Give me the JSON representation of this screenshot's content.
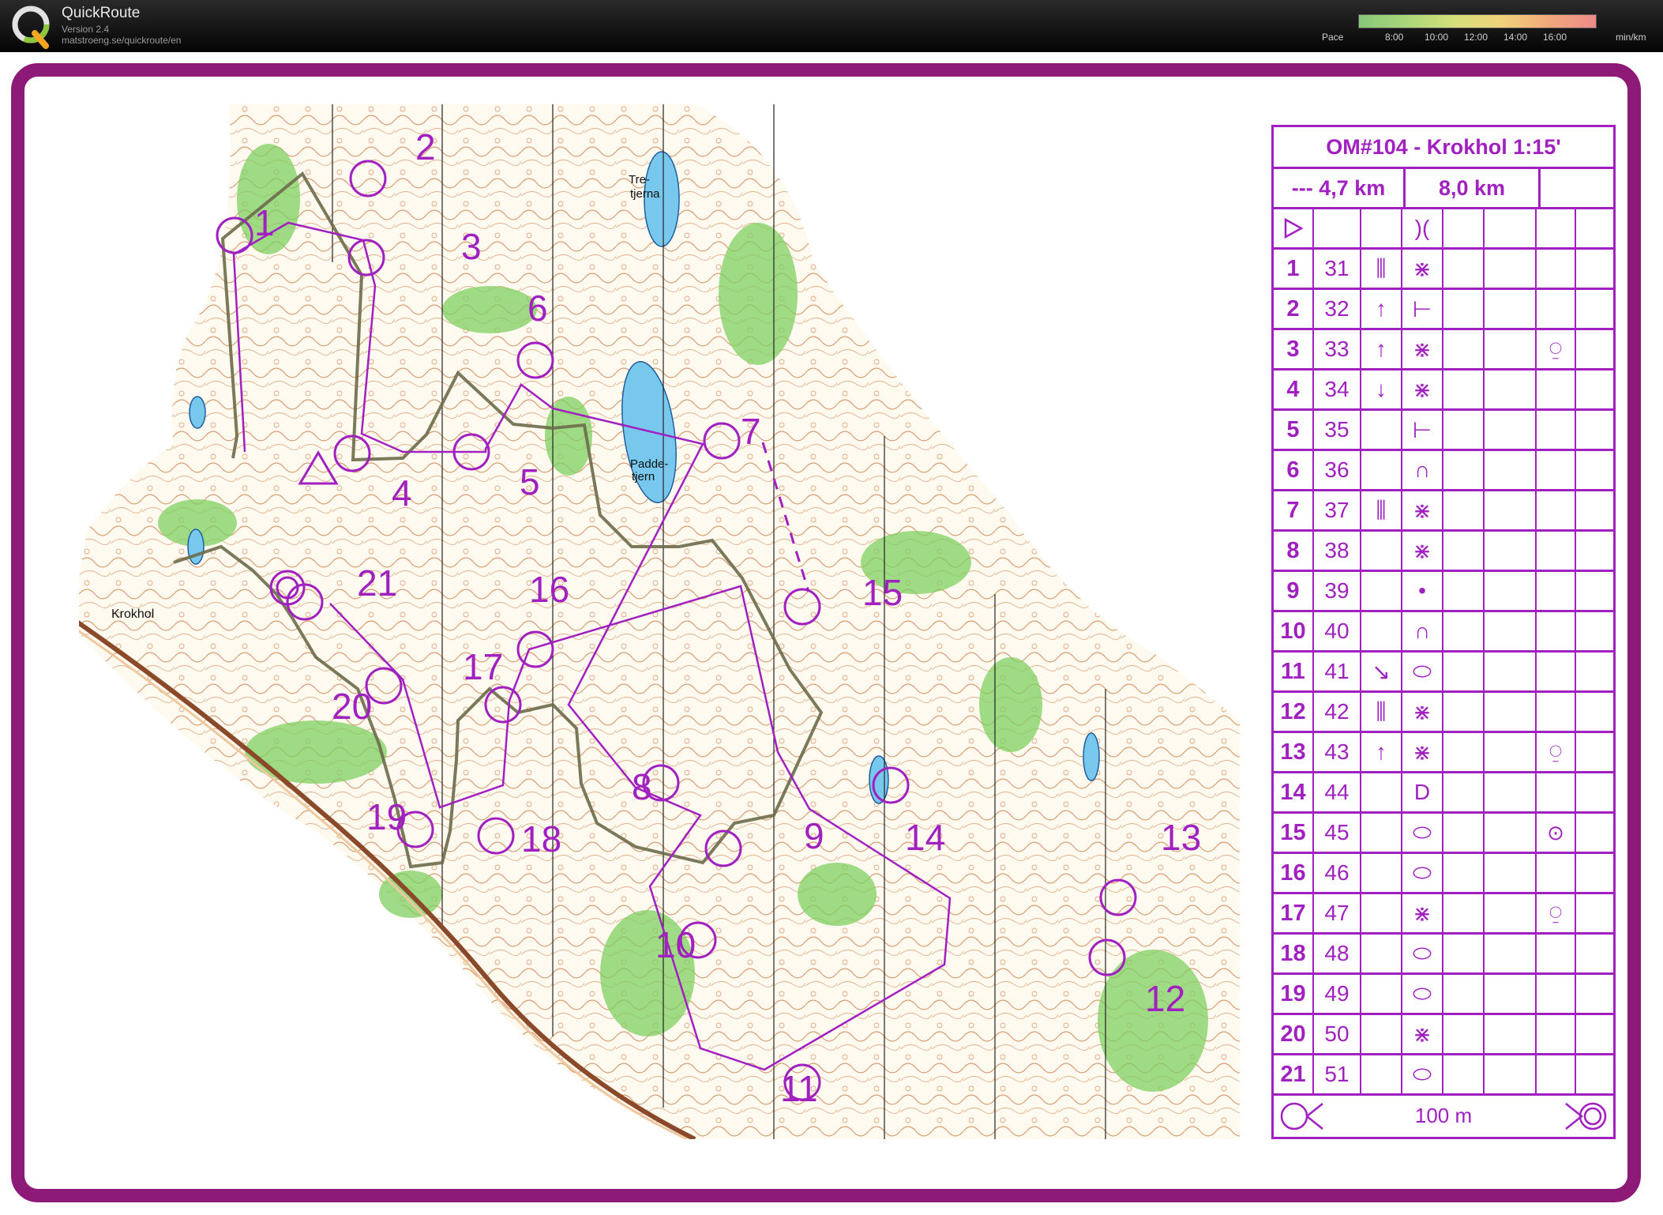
{
  "app": {
    "name": "QuickRoute",
    "version": "Version 2.4",
    "url": "matstroeng.se/quickroute/en",
    "logo_icon": "quickroute-q-logo"
  },
  "pace_legend": {
    "label": "Pace",
    "ticks": [
      "8:00",
      "10:00",
      "12:00",
      "14:00",
      "16:00"
    ],
    "unit": "min/km"
  },
  "colors": {
    "frame": "#8e1a77",
    "course": "#a020c0",
    "route": "#6b6b4a",
    "forest": "#7fcf62",
    "contour": "#c8733a",
    "water": "#78c8ee",
    "pace_slow": "#ee8a8a",
    "pace_fast": "#87c77a"
  },
  "map": {
    "place_names": [
      "Tre-\ntjerna",
      "Padde-\ntjern",
      "Krokhol"
    ],
    "controls": [
      {
        "label": "1"
      },
      {
        "label": "2"
      },
      {
        "label": "3"
      },
      {
        "label": "4"
      },
      {
        "label": "5"
      },
      {
        "label": "6"
      },
      {
        "label": "7"
      },
      {
        "label": "8"
      },
      {
        "label": "9"
      },
      {
        "label": "10"
      },
      {
        "label": "11"
      },
      {
        "label": "12"
      },
      {
        "label": "13"
      },
      {
        "label": "14"
      },
      {
        "label": "15"
      },
      {
        "label": "16"
      },
      {
        "label": "17"
      },
      {
        "label": "18"
      },
      {
        "label": "19"
      },
      {
        "label": "20"
      },
      {
        "label": "21"
      }
    ]
  },
  "description_sheet": {
    "title": "OM#104 - Krokhol 1:15'",
    "length_a": "--- 4,7 km",
    "length_b": "8,0 km",
    "start_symbol": "start-triangle-icon",
    "start_feature": ")(",
    "rows": [
      {
        "num": "1",
        "code": "31",
        "which": "⫼",
        "feature": "⋇",
        "extra": ""
      },
      {
        "num": "2",
        "code": "32",
        "which": "↑",
        "feature": "⊢",
        "extra": ""
      },
      {
        "num": "3",
        "code": "33",
        "which": "↑",
        "feature": "⋇",
        "extra": "⍜"
      },
      {
        "num": "4",
        "code": "34",
        "which": "↓",
        "feature": "⋇",
        "extra": ""
      },
      {
        "num": "5",
        "code": "35",
        "which": "",
        "feature": "⊢",
        "extra": ""
      },
      {
        "num": "6",
        "code": "36",
        "which": "",
        "feature": "∩",
        "extra": ""
      },
      {
        "num": "7",
        "code": "37",
        "which": "⫼",
        "feature": "⋇",
        "extra": ""
      },
      {
        "num": "8",
        "code": "38",
        "which": "",
        "feature": "⋇",
        "extra": ""
      },
      {
        "num": "9",
        "code": "39",
        "which": "",
        "feature": "•",
        "extra": ""
      },
      {
        "num": "10",
        "code": "40",
        "which": "",
        "feature": "∩",
        "extra": ""
      },
      {
        "num": "11",
        "code": "41",
        "which": "↘",
        "feature": "⬭",
        "extra": ""
      },
      {
        "num": "12",
        "code": "42",
        "which": "⫼",
        "feature": "⋇",
        "extra": ""
      },
      {
        "num": "13",
        "code": "43",
        "which": "↑",
        "feature": "⋇",
        "extra": "⍜"
      },
      {
        "num": "14",
        "code": "44",
        "which": "",
        "feature": "D",
        "extra": ""
      },
      {
        "num": "15",
        "code": "45",
        "which": "",
        "feature": "⬭",
        "extra": "⊙"
      },
      {
        "num": "16",
        "code": "46",
        "which": "",
        "feature": "⬭",
        "extra": ""
      },
      {
        "num": "17",
        "code": "47",
        "which": "",
        "feature": "⋇",
        "extra": "⍜"
      },
      {
        "num": "18",
        "code": "48",
        "which": "",
        "feature": "⬭",
        "extra": ""
      },
      {
        "num": "19",
        "code": "49",
        "which": "",
        "feature": "⬭",
        "extra": ""
      },
      {
        "num": "20",
        "code": "50",
        "which": "",
        "feature": "⋇",
        "extra": ""
      },
      {
        "num": "21",
        "code": "51",
        "which": "",
        "feature": "⬭",
        "extra": ""
      }
    ],
    "footer": "100 m",
    "footer_left_icon": "control-to-finish-marked-route-icon",
    "footer_right_icon": "finish-circle-icon"
  }
}
